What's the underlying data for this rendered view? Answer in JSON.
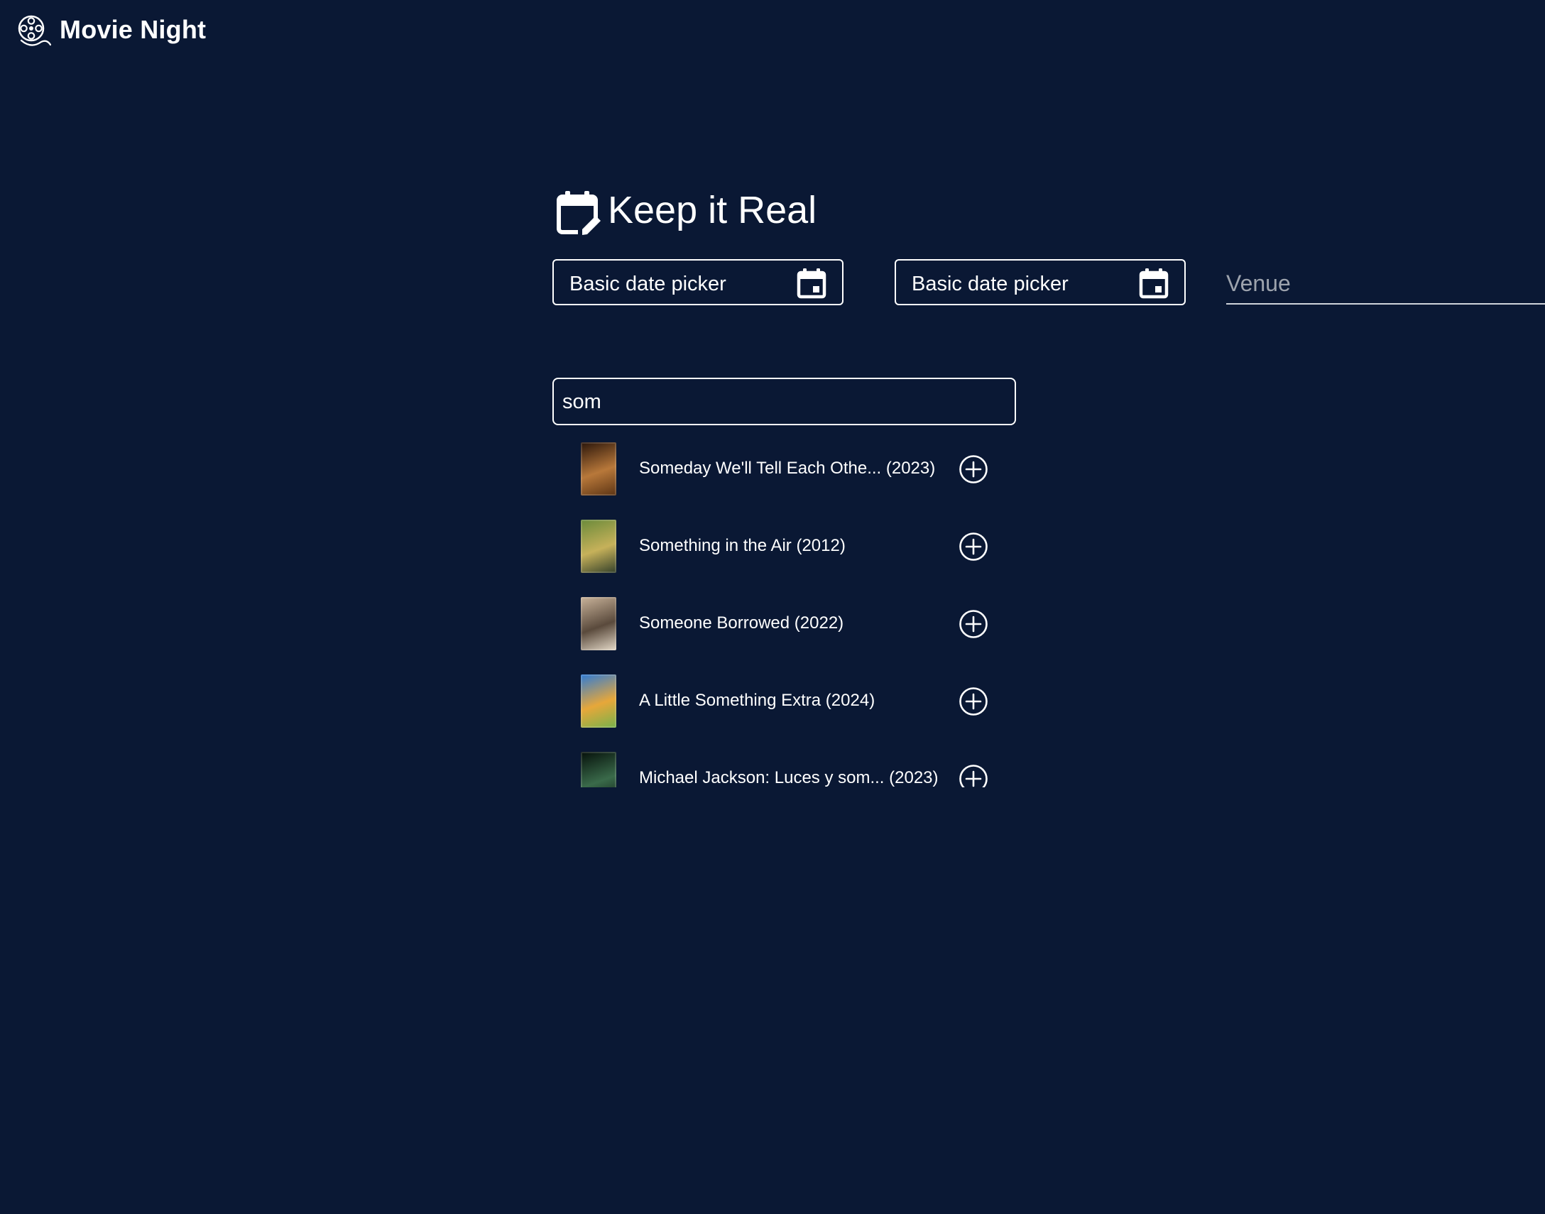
{
  "app": {
    "title": "Movie Night"
  },
  "event": {
    "title": "Keep it Real"
  },
  "form": {
    "start_date_label": "Basic date picker",
    "end_date_label": "Basic date picker",
    "venue_placeholder": "Venue",
    "venue_value": ""
  },
  "search": {
    "value": "som"
  },
  "results": [
    {
      "title": "Someday We'll Tell Each Othe... (2023)",
      "poster_colors": [
        "#2a150a",
        "#b8783a",
        "#5c3414"
      ]
    },
    {
      "title": "Something in the Air (2012)",
      "poster_colors": [
        "#6a8a3a",
        "#c6b15a",
        "#33402a"
      ]
    },
    {
      "title": "Someone Borrowed (2022)",
      "poster_colors": [
        "#c9b39a",
        "#5a4a3c",
        "#e4d9c8"
      ]
    },
    {
      "title": "A Little Something Extra (2024)",
      "poster_colors": [
        "#2f7bd6",
        "#e7a73a",
        "#78b24b"
      ]
    },
    {
      "title": "Michael Jackson: Luces y som... (2023)",
      "poster_colors": [
        "#05100a",
        "#3a6a4a",
        "#0c1a12"
      ]
    }
  ],
  "colors": {
    "background": "#0a1834",
    "foreground": "#ffffff",
    "placeholder": "#9da3ad"
  },
  "icons": {
    "logo": "film-reel-icon",
    "title": "calendar-edit-icon",
    "date": "calendar-icon",
    "add": "add-circle-icon"
  }
}
